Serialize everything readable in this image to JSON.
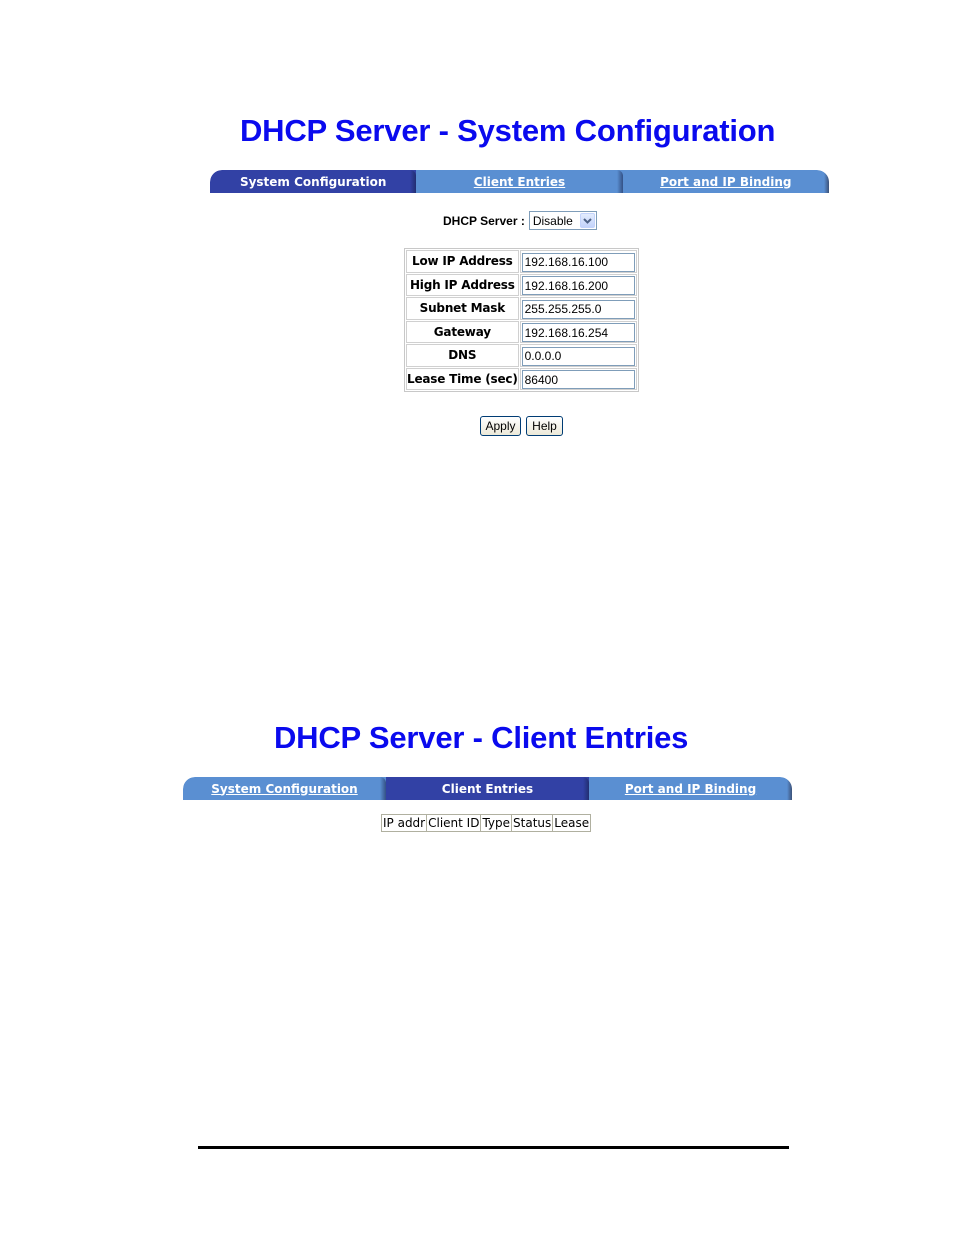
{
  "section1": {
    "title": "DHCP Server - System Configuration",
    "tabs": [
      {
        "label": "System Configuration",
        "active": true
      },
      {
        "label": "Client Entries",
        "active": false
      },
      {
        "label": "Port and IP Binding",
        "active": false
      }
    ],
    "dhcp_server": {
      "label": "DHCP Server :",
      "selected": "Disable",
      "arrow_icon": "chevron-down-icon"
    },
    "fields": [
      {
        "label": "Low IP Address",
        "value": "192.168.16.100"
      },
      {
        "label": "High IP Address",
        "value": "192.168.16.200"
      },
      {
        "label": "Subnet Mask",
        "value": "255.255.255.0"
      },
      {
        "label": "Gateway",
        "value": "192.168.16.254"
      },
      {
        "label": "DNS",
        "value": "0.0.0.0"
      },
      {
        "label": "Lease Time (sec)",
        "value": "86400"
      }
    ],
    "buttons": {
      "apply": "Apply",
      "help": "Help"
    }
  },
  "section2": {
    "title": "DHCP Server - Client Entries",
    "tabs": [
      {
        "label": "System Configuration",
        "active": false
      },
      {
        "label": "Client Entries",
        "active": true
      },
      {
        "label": "Port and IP Binding",
        "active": false
      }
    ],
    "table_headers": [
      "IP addr",
      "Client ID",
      "Type",
      "Status",
      "Lease"
    ],
    "rows": []
  },
  "colors": {
    "title_blue": "#0a0aee",
    "tab_active": "#3241a5",
    "tab_inactive": "#5a8fd2"
  },
  "icons": {
    "chevron": "⌄"
  }
}
